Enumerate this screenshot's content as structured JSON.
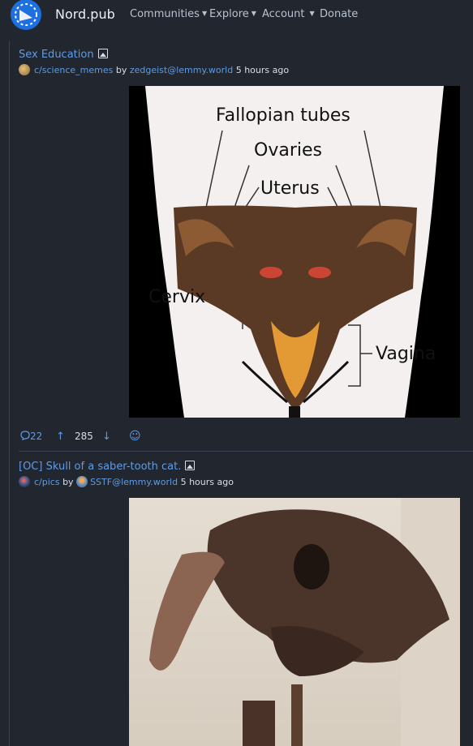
{
  "site": {
    "name": "Nord.pub",
    "nav": [
      {
        "label": "Communities",
        "has_dropdown": true
      },
      {
        "label": "Explore",
        "has_dropdown": true
      },
      {
        "label": "Account",
        "has_dropdown": true
      },
      {
        "label": "Donate",
        "has_dropdown": false
      }
    ]
  },
  "posts": [
    {
      "title": "Sex Education",
      "community": "c/science_memes",
      "by": "by",
      "author": "zedgeist@lemmy.world",
      "time": "5 hours ago",
      "image_labels": [
        "Fallopian tubes",
        "Ovaries",
        "Uterus",
        "Cervix",
        "Vagina"
      ],
      "comments": "22",
      "score": "285"
    },
    {
      "title": "[OC] Skull of a saber-tooth cat.",
      "community": "c/pics",
      "by": "by",
      "author": "SSTF@lemmy.world",
      "time": "5 hours ago"
    }
  ],
  "colors": {
    "background": "#21262f",
    "link": "#5e9ce6",
    "text": "#d8dee9",
    "logo": "#1e6fe0"
  }
}
